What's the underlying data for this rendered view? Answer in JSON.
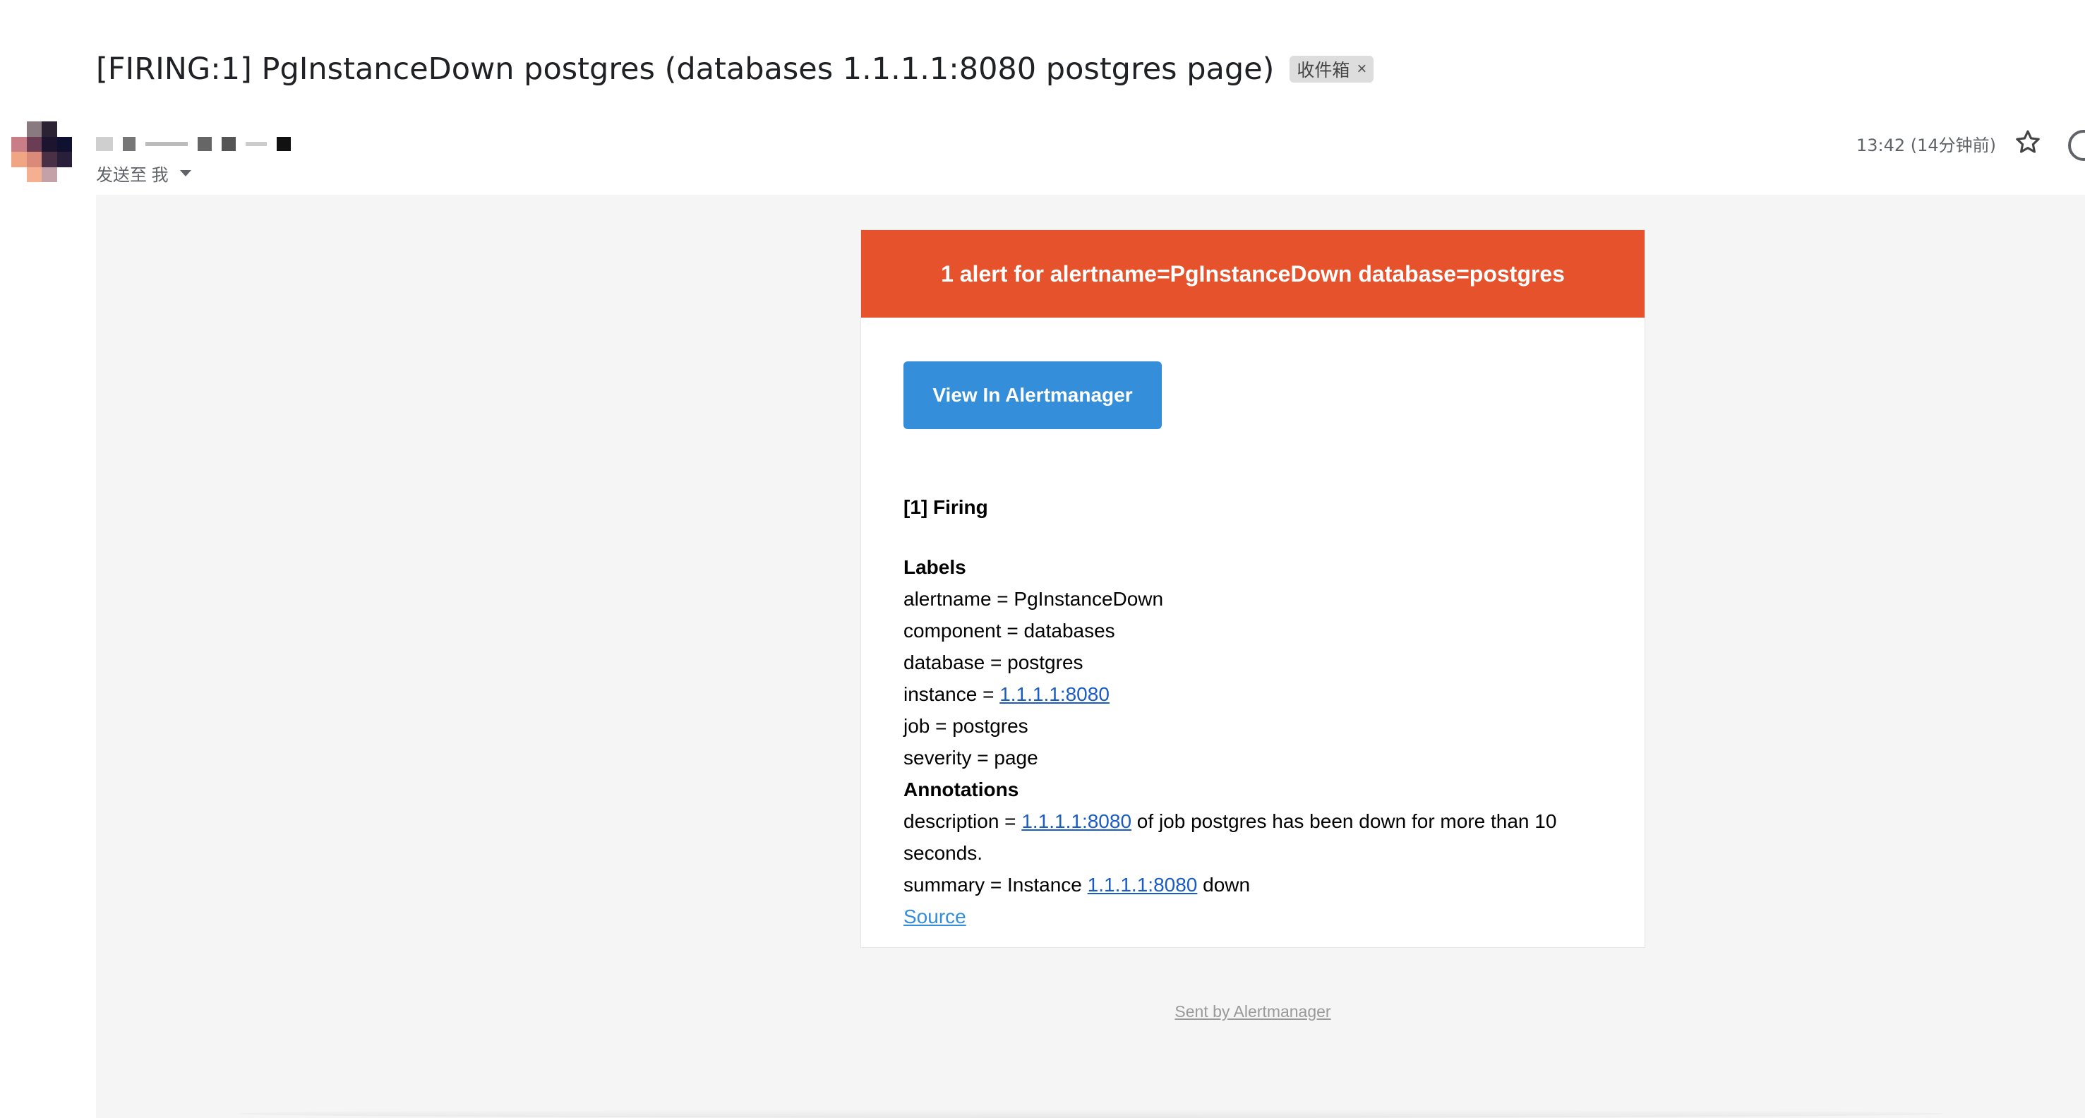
{
  "email": {
    "subject": "[FIRING:1] PgInstanceDown postgres (databases 1.1.1.1:8080 postgres page)",
    "label_chip": "收件箱",
    "chip_close": "×",
    "recipient": "发送至 我",
    "timestamp": "13:42 (14分钟前)"
  },
  "alert": {
    "header": "1 alert for alertname=PgInstanceDown database=postgres",
    "view_button": "View In Alertmanager",
    "firing_title": "[1] Firing",
    "labels_heading": "Labels",
    "labels": {
      "alertname": "alertname = PgInstanceDown",
      "component": "component = databases",
      "database": "database = postgres",
      "instance_prefix": "instance = ",
      "instance_link": "1.1.1.1:8080",
      "job": "job = postgres",
      "severity": "severity = page"
    },
    "annotations_heading": "Annotations",
    "annotations": {
      "description_prefix": "description = ",
      "description_link": "1.1.1.1:8080",
      "description_suffix": " of job postgres has been down for more than 10 seconds.",
      "summary_prefix": "summary = Instance ",
      "summary_link": "1.1.1.1:8080",
      "summary_suffix": " down"
    },
    "source_link": "Source",
    "footer": "Sent by Alertmanager"
  },
  "colors": {
    "alert_header": "#e6522c",
    "button": "#348eda",
    "link": "#1a5bc4",
    "body_bg": "#f5f5f5"
  },
  "icons": [
    "star-icon",
    "caret-down-icon",
    "close-icon"
  ]
}
